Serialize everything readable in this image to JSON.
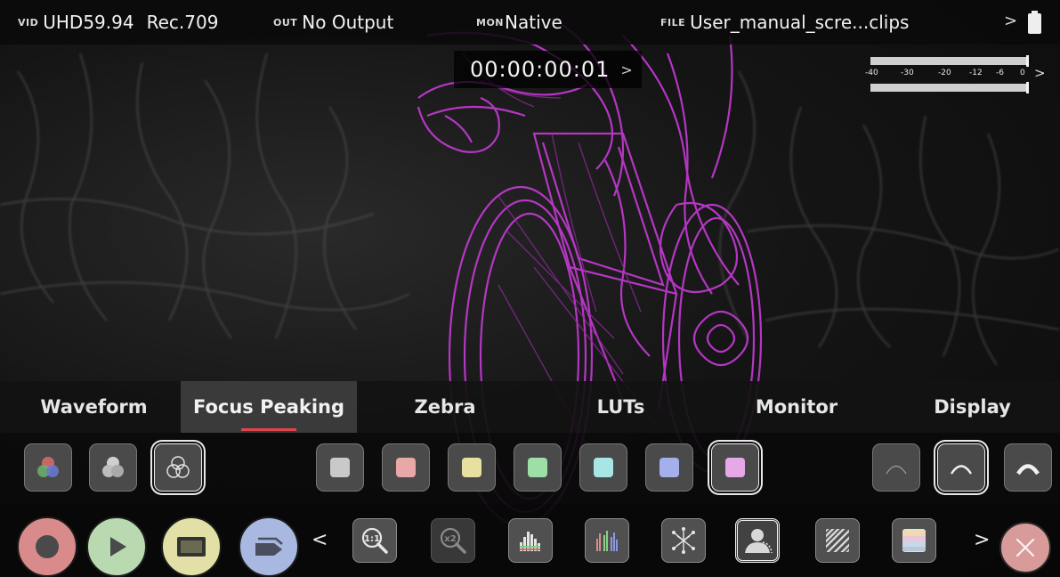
{
  "status_bar": {
    "video": {
      "tag": "VID",
      "format": "UHD59.94",
      "colorspace": "Rec.709"
    },
    "output": {
      "tag": "OUT",
      "value": "No Output"
    },
    "monitor": {
      "tag": "MON",
      "value": "Native"
    },
    "file": {
      "tag": "FILE",
      "value": "User_manual_scre...clips"
    },
    "more_chevron": ">",
    "battery_icon": "battery-icon"
  },
  "timecode": {
    "value": "00:00:00:01",
    "chevron": ">"
  },
  "audio_meter": {
    "scale": [
      "-40",
      "-30",
      "-20",
      "-12",
      "-6",
      "0"
    ],
    "chevron": ">"
  },
  "tabs": [
    {
      "label": "Waveform",
      "active": false
    },
    {
      "label": "Focus Peaking",
      "active": true
    },
    {
      "label": "Zebra",
      "active": false
    },
    {
      "label": "LUTs",
      "active": false
    },
    {
      "label": "Monitor",
      "active": false
    },
    {
      "label": "Display",
      "active": false
    }
  ],
  "focus_peaking": {
    "modes": [
      {
        "icon": "rgb-circles-color-icon",
        "selected": false
      },
      {
        "icon": "rgb-circles-gray-icon",
        "selected": false
      },
      {
        "icon": "outline-circles-icon",
        "selected": true
      }
    ],
    "colors": [
      {
        "hex": "#c9c9c9",
        "selected": false
      },
      {
        "hex": "#e8a8a8",
        "selected": false
      },
      {
        "hex": "#e8e0a0",
        "selected": false
      },
      {
        "hex": "#9ce0a8",
        "selected": false
      },
      {
        "hex": "#a8e6e6",
        "selected": false
      },
      {
        "hex": "#a4b0ec",
        "selected": false
      },
      {
        "hex": "#e6a8e6",
        "selected": true
      }
    ],
    "levels": [
      {
        "icon": "arc-thin-icon",
        "selected": false
      },
      {
        "icon": "arc-medium-icon",
        "selected": true
      },
      {
        "icon": "arc-thick-icon",
        "selected": false
      }
    ]
  },
  "toolbar": {
    "record": {
      "icon": "record-icon",
      "color": "#d98b8b"
    },
    "play": {
      "icon": "play-icon",
      "color": "#b9d9b0"
    },
    "monitor": {
      "icon": "monitor-mode-icon",
      "color": "#e2e0a6"
    },
    "tag": {
      "icon": "tag-icon",
      "color": "#a8b8e0"
    },
    "prev_chevron": "<",
    "next_chevron": ">",
    "tools": [
      {
        "icon": "zoom-1to1-icon",
        "label": "1:1",
        "selected": false,
        "dimmed": false
      },
      {
        "icon": "zoom-x2-icon",
        "label": "x2",
        "selected": false,
        "dimmed": true
      },
      {
        "icon": "histogram-icon",
        "selected": false,
        "dimmed": false
      },
      {
        "icon": "rgb-parade-icon",
        "selected": false,
        "dimmed": false
      },
      {
        "icon": "vectorscope-icon",
        "selected": false,
        "dimmed": false
      },
      {
        "icon": "focus-peaking-person-icon",
        "selected": true,
        "dimmed": false
      },
      {
        "icon": "zebra-stripes-icon",
        "selected": false,
        "dimmed": false
      },
      {
        "icon": "false-color-icon",
        "selected": false,
        "dimmed": false
      }
    ],
    "close": {
      "icon": "close-icon",
      "color": "#e0a0a0"
    }
  }
}
